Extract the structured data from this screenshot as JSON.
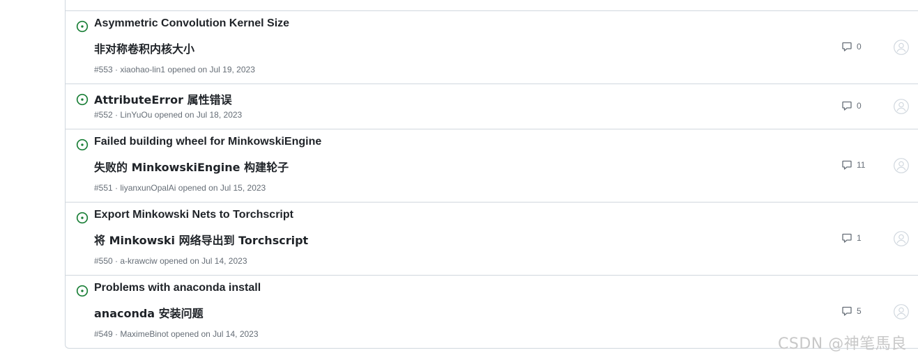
{
  "issues": [
    {
      "title": "Asymmetric Convolution Kernel Size",
      "translation": "非对称卷积内核大小",
      "number": "#553",
      "author": "xiaohao-lin1",
      "opened": "opened on Jul 19, 2023",
      "comments": "0"
    },
    {
      "title": "AttributeError 属性错误",
      "translation": "",
      "number": "#552",
      "author": "LinYuOu",
      "opened": "opened on Jul 18, 2023",
      "comments": "0"
    },
    {
      "title": "Failed building wheel for MinkowskiEngine",
      "translation": "失败的 MinkowskiEngine 构建轮子",
      "number": "#551",
      "author": "liyanxunOpalAi",
      "opened": "opened on Jul 15, 2023",
      "comments": "11"
    },
    {
      "title": "Export Minkowski Nets to Torchscript",
      "translation": "将 Minkowski 网络导出到 Torchscript",
      "number": "#550",
      "author": "a-krawciw",
      "opened": "opened on Jul 14, 2023",
      "comments": "1"
    },
    {
      "title": "Problems with anaconda install",
      "translation": "anaconda 安装问题",
      "number": "#549",
      "author": "MaximeBinot",
      "opened": "opened on Jul 14, 2023",
      "comments": "5"
    }
  ],
  "separator": " · ",
  "icons": {
    "state": "issue-opened-icon",
    "comment": "comment-icon",
    "avatar": "person-icon"
  },
  "colors": {
    "open": "#1a7f37",
    "muted": "#656d76",
    "border": "#d0d7de"
  },
  "watermark": "CSDN @神笔馬良"
}
